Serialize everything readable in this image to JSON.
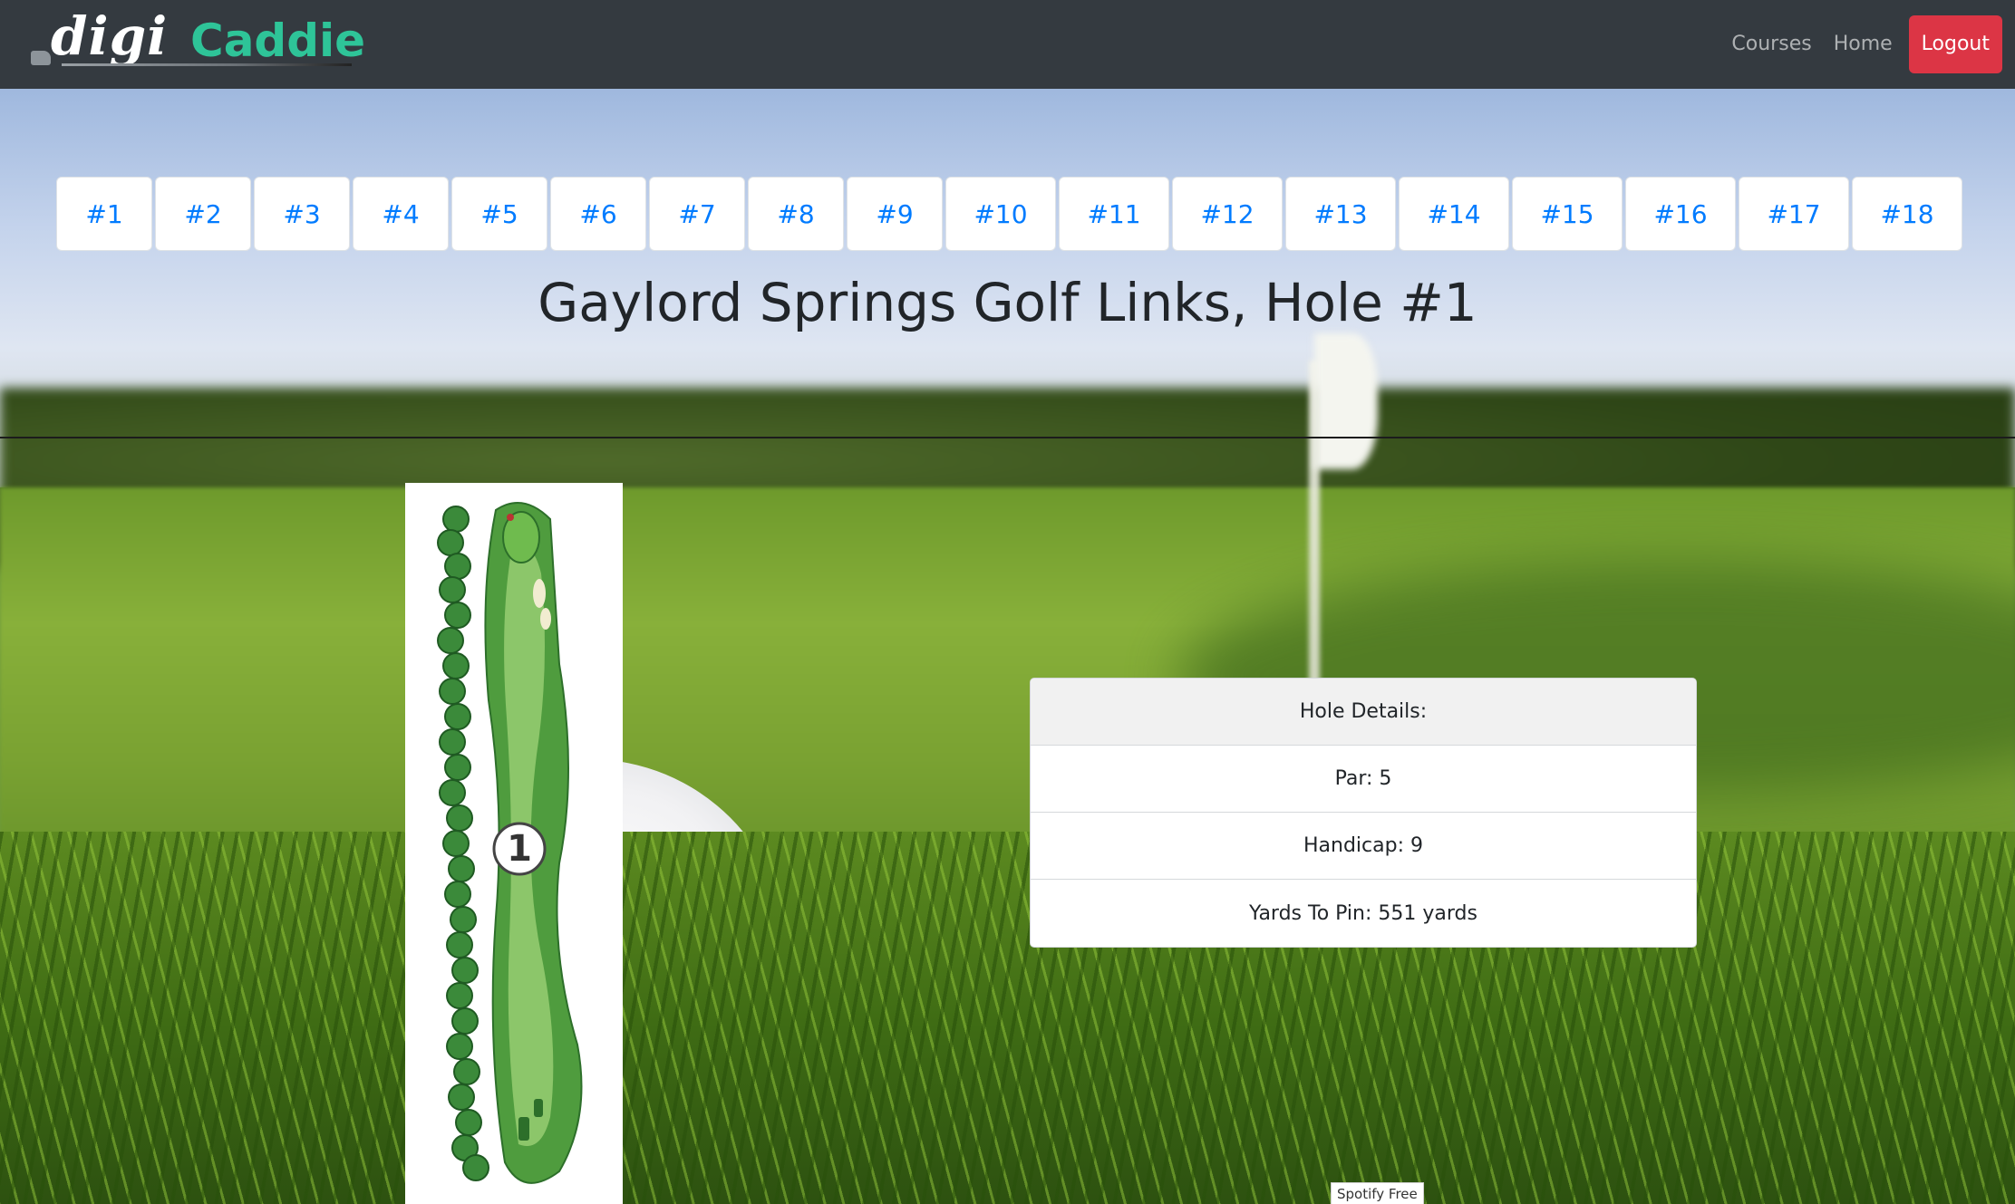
{
  "navbar": {
    "brand_part1": "digi",
    "brand_part2": "Caddie",
    "links": [
      "Courses",
      "Home"
    ],
    "logout_label": "Logout"
  },
  "holes": [
    "#1",
    "#2",
    "#3",
    "#4",
    "#5",
    "#6",
    "#7",
    "#8",
    "#9",
    "#10",
    "#11",
    "#12",
    "#13",
    "#14",
    "#15",
    "#16",
    "#17",
    "#18"
  ],
  "title": "Gaylord Springs Golf Links, Hole #1",
  "hole_map": {
    "hole_number": "1"
  },
  "details": {
    "header": "Hole Details:",
    "par": "Par: 5",
    "handicap": "Handicap: 9",
    "yards": "Yards To Pin: 551 yards"
  },
  "footer_badge": "Spotify Free",
  "colors": {
    "navbar_bg": "#343a40",
    "brand_accent": "#2ec498",
    "logout_bg": "#dc3545",
    "link_blue": "#007bff"
  }
}
